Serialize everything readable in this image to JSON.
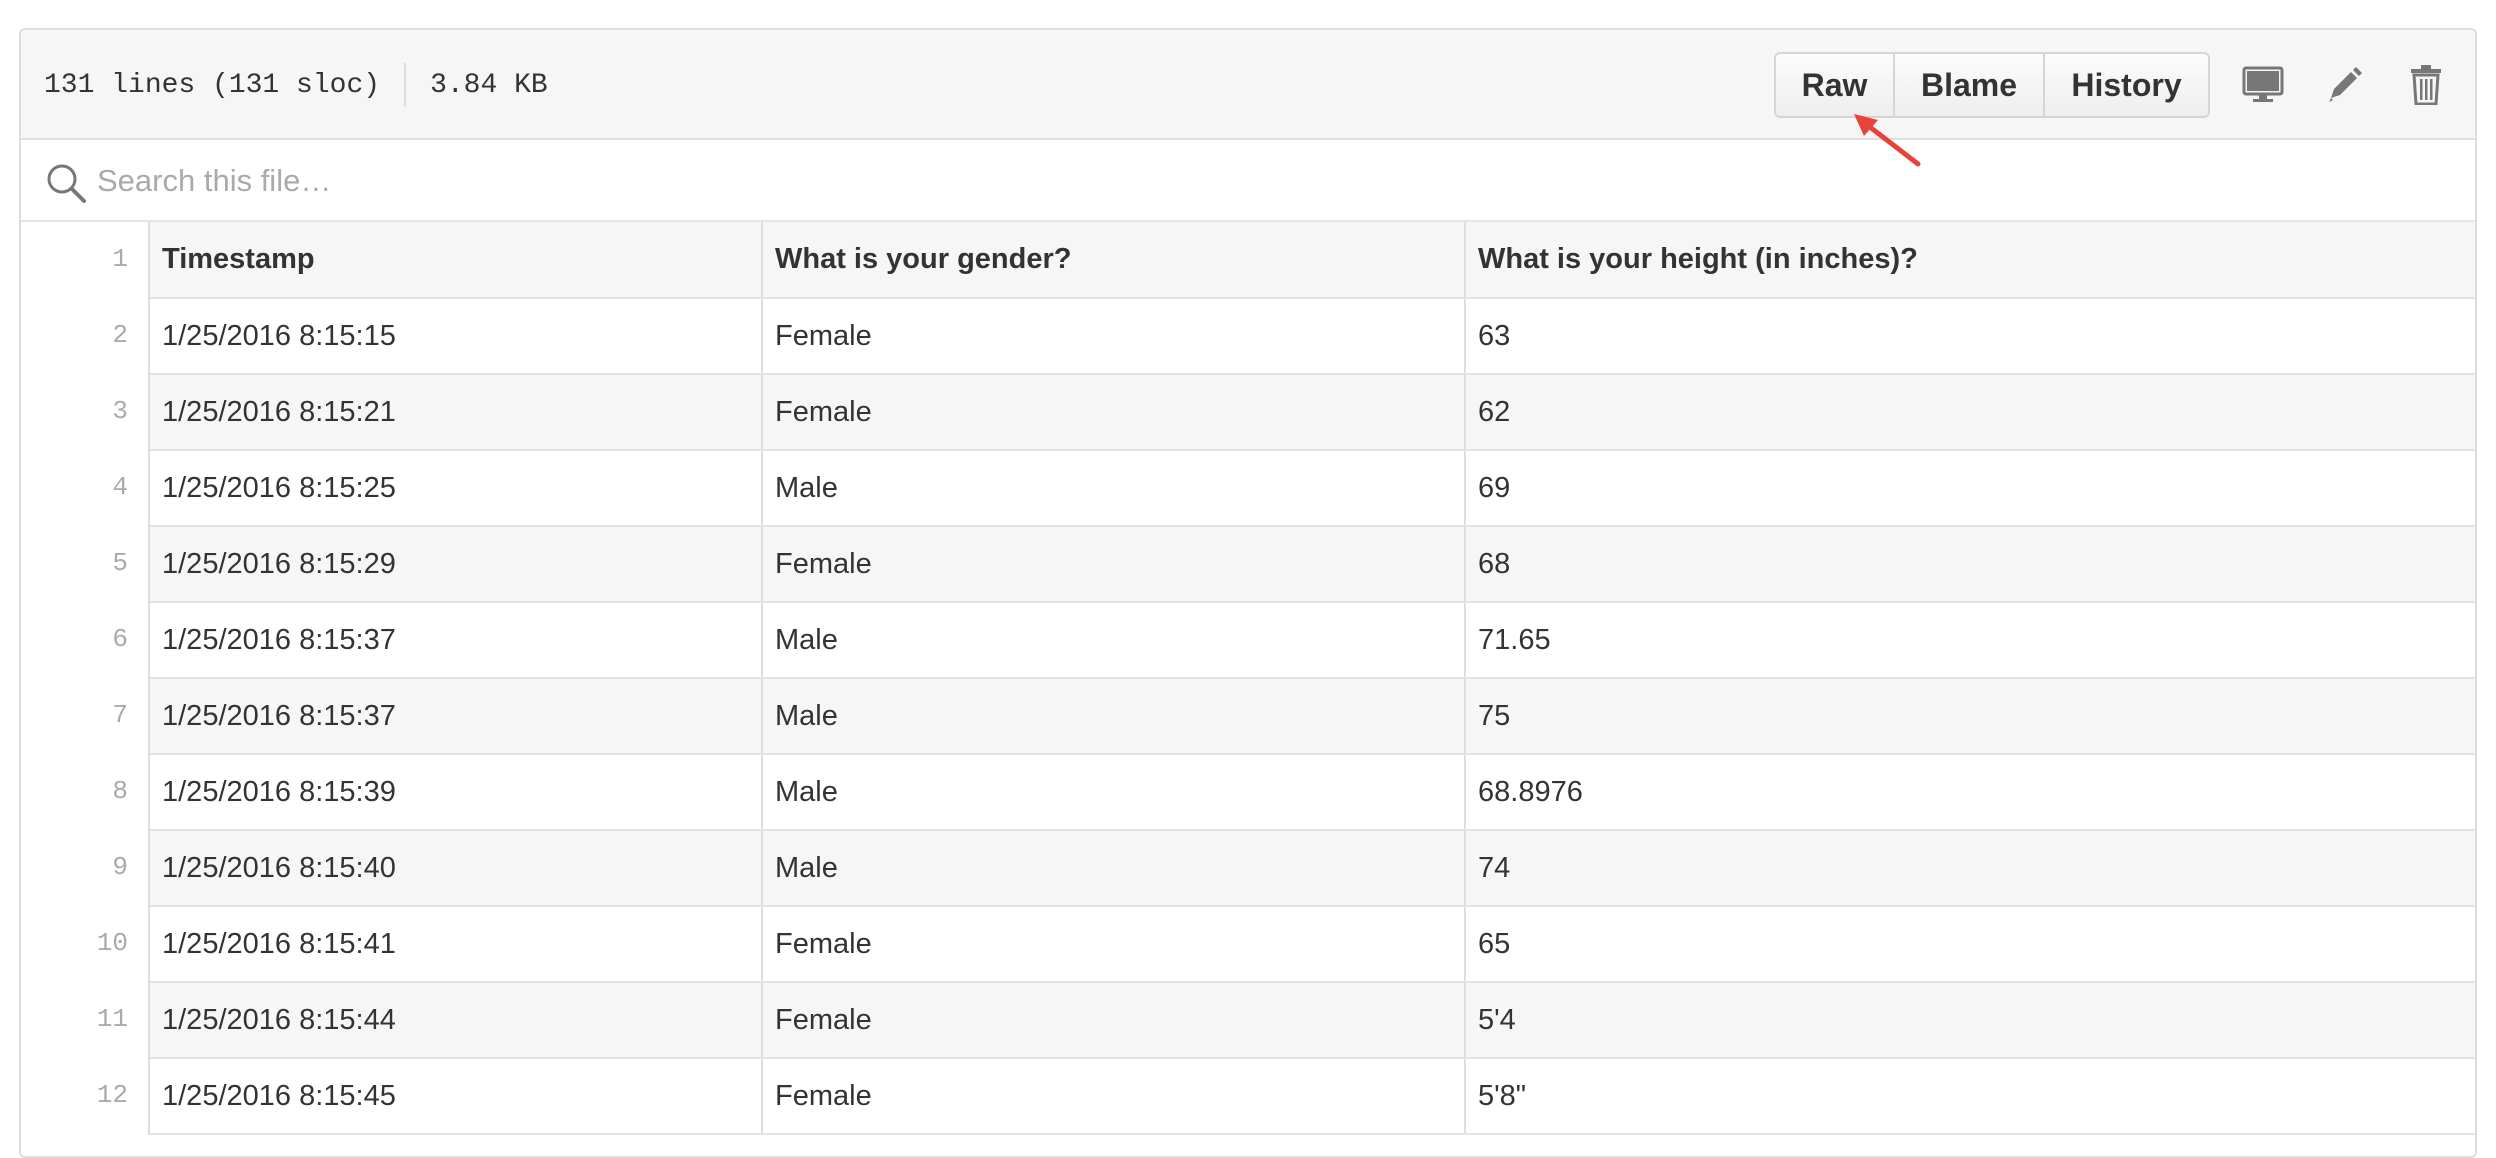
{
  "file_info": {
    "lines": "131 lines (131 sloc)",
    "size": "3.84 KB"
  },
  "toolbar": {
    "raw_label": "Raw",
    "blame_label": "Blame",
    "history_label": "History",
    "icons": [
      "desktop-icon",
      "pencil-icon",
      "trash-icon"
    ]
  },
  "search": {
    "placeholder": "Search this file…"
  },
  "table": {
    "header_line": "1",
    "headers": [
      "Timestamp",
      "What is your gender?",
      "What is your height (in inches)?"
    ],
    "rows": [
      {
        "line": "2",
        "cells": [
          "1/25/2016 8:15:15",
          "Female",
          "63"
        ]
      },
      {
        "line": "3",
        "cells": [
          "1/25/2016 8:15:21",
          "Female",
          "62"
        ]
      },
      {
        "line": "4",
        "cells": [
          "1/25/2016 8:15:25",
          "Male",
          "69"
        ]
      },
      {
        "line": "5",
        "cells": [
          "1/25/2016 8:15:29",
          "Female",
          "68"
        ]
      },
      {
        "line": "6",
        "cells": [
          "1/25/2016 8:15:37",
          "Male",
          "71.65"
        ]
      },
      {
        "line": "7",
        "cells": [
          "1/25/2016 8:15:37",
          "Male",
          "75"
        ]
      },
      {
        "line": "8",
        "cells": [
          "1/25/2016 8:15:39",
          "Male",
          "68.8976"
        ]
      },
      {
        "line": "9",
        "cells": [
          "1/25/2016 8:15:40",
          "Male",
          "74"
        ]
      },
      {
        "line": "10",
        "cells": [
          "1/25/2016 8:15:41",
          "Female",
          "65"
        ]
      },
      {
        "line": "11",
        "cells": [
          "1/25/2016 8:15:44",
          "Female",
          "5'4"
        ]
      },
      {
        "line": "12",
        "cells": [
          "1/25/2016 8:15:45",
          "Female",
          "5'8\""
        ]
      }
    ]
  },
  "colors": {
    "annotation_arrow": "#e8433a",
    "header_bg": "#f6f6f6",
    "border": "#dddddd"
  }
}
